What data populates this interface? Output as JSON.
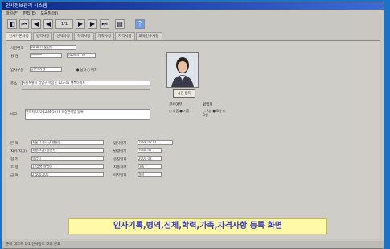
{
  "window": {
    "title": "인사정보관리 시스템"
  },
  "menu": [
    "파일(F)",
    "편집(E)",
    "도움말(H)"
  ],
  "toolbar": {
    "buttons": [
      {
        "name": "save-button",
        "glyph": "◧"
      },
      {
        "name": "first-record-button",
        "glyph": "⏮"
      },
      {
        "name": "prev-record-button",
        "glyph": "◀"
      },
      {
        "name": "prev-page-button",
        "glyph": "◀"
      },
      {
        "name": "record-indicator",
        "glyph": "1/1"
      },
      {
        "name": "next-page-button",
        "glyph": "▶"
      },
      {
        "name": "next-record-button",
        "glyph": "▶"
      },
      {
        "name": "last-record-button",
        "glyph": "⏭"
      },
      {
        "name": "print-button",
        "glyph": "▤"
      },
      {
        "name": "help-button",
        "glyph": "?"
      }
    ]
  },
  "tabs": [
    "인사기본사항",
    "병역사항",
    "신체사항",
    "학력사항",
    "가족사항",
    "자격사항",
    "교육연수사항"
  ],
  "form": {
    "emp_no_label": "사원번호",
    "emp_no": "880801 홍길동",
    "name_label": "성 명",
    "name": "*******",
    "birth": "1980.01.01",
    "dept_label": "입사구분",
    "dept": "정규직사원",
    "gender_label": "● 남자  ○ 여자",
    "address_label": "주소",
    "address": "서울특별시 강남구 역삼동 123-45 행복아파트",
    "memo_label": "비고",
    "memo": "연락처 010-1234-5678 비상연락망 등록",
    "photo_button": "사진 등록",
    "marital_label": "결혼여부",
    "marital_opts": "○ 미혼  ● 기혼",
    "blood_label": "혈액형",
    "blood_opts": "○ A형  ● B형  ○ O형",
    "rows": [
      {
        "l1": "본 적",
        "v1": "서울시 종로구 명륜동",
        "l2": "입사일자",
        "v2": "1988.08.01"
      },
      {
        "l1": "직위(직급)",
        "v1": "사원(4급) 영업부",
        "l2": "발령일자",
        "v2": "1999.01"
      },
      {
        "l1": "현 직",
        "v1": "영업팀",
        "l2": "승진일자",
        "v2": "2001.03"
      },
      {
        "l1": "호 봉",
        "v1": "12호봉 영업팀",
        "l2": "최종학력",
        "v2": "대졸"
      },
      {
        "l1": "급 여",
        "v1": "2,500,000",
        "l2": "퇴직일자",
        "v2": "재직"
      }
    ]
  },
  "banner": "인사기록,병역,신체,학력,가족,자격사항 등록 화면",
  "status": "준비  레코드 1/1  인사정보 조회 완료"
}
